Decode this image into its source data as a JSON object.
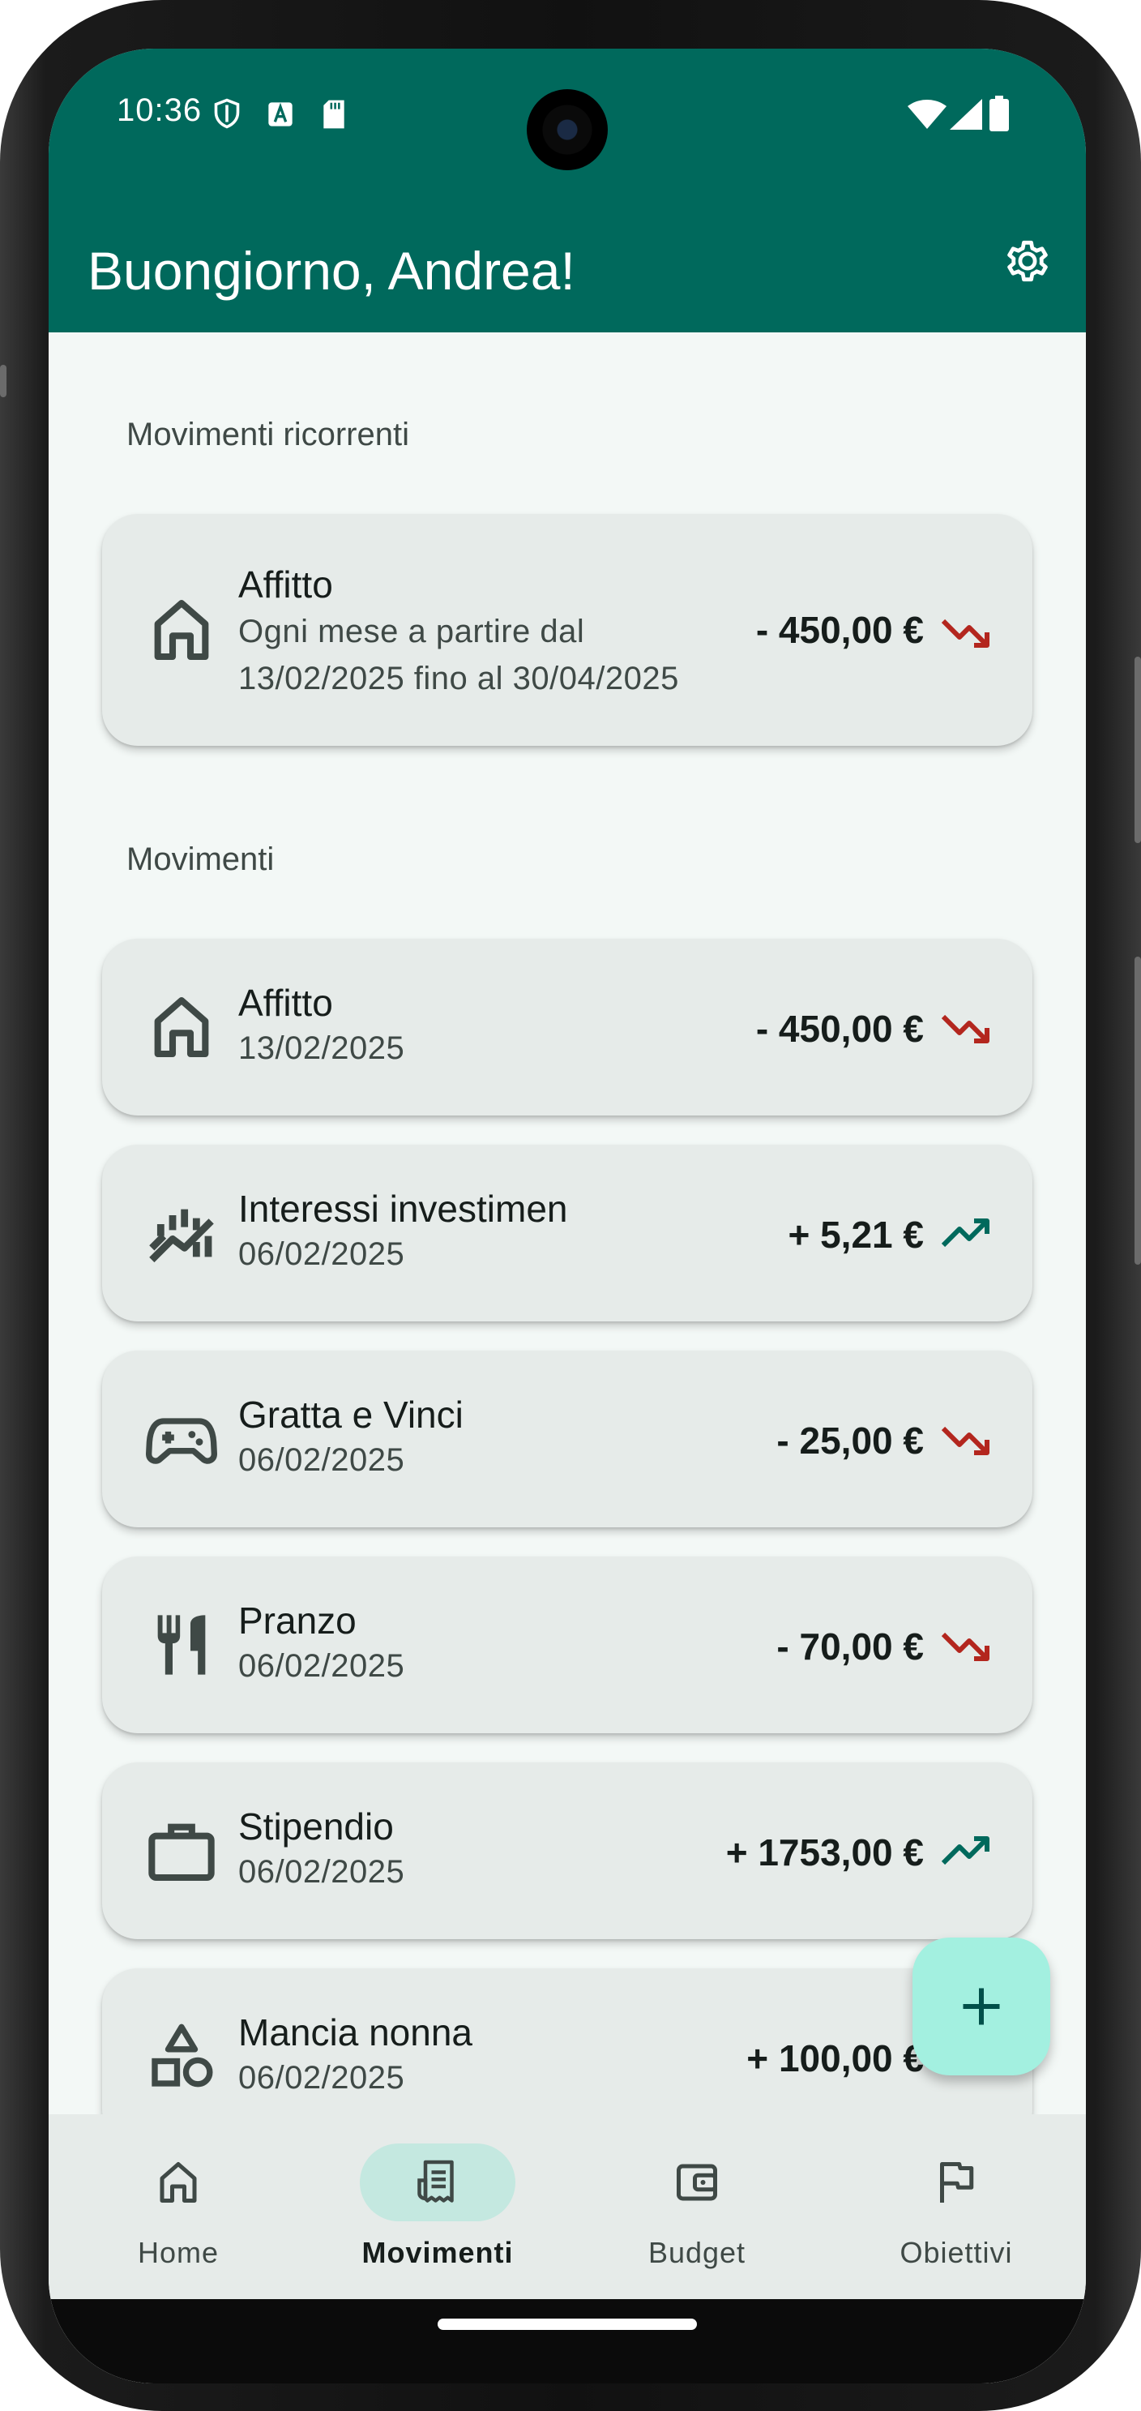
{
  "status": {
    "time": "10:36"
  },
  "header": {
    "greeting": "Buongiorno, Andrea!"
  },
  "colors": {
    "primary": "#00695c",
    "negative": "#b3261e",
    "positive": "#00695c",
    "card": "#e6ebe9",
    "fab": "#a3f0e0"
  },
  "recurring": {
    "section_title": "Movimenti ricorrenti",
    "items": [
      {
        "title": "Affitto",
        "line1": "Ogni mese a partire dal",
        "line2": "13/02/2025 fino al 30/04/2025",
        "amount": "- 450,00 €",
        "icon": "house-icon",
        "trend": "down"
      }
    ]
  },
  "movements": {
    "section_title": "Movimenti",
    "items": [
      {
        "title": "Affitto",
        "date": "13/02/2025",
        "amount": "- 450,00 €",
        "icon": "house-icon",
        "trend": "down"
      },
      {
        "title": "Interessi investimen",
        "date": "06/02/2025",
        "amount": "+ 5,21 €",
        "icon": "investment-chart-icon",
        "trend": "up"
      },
      {
        "title": "Gratta e Vinci",
        "date": "06/02/2025",
        "amount": "- 25,00 €",
        "icon": "gamepad-icon",
        "trend": "down"
      },
      {
        "title": "Pranzo",
        "date": "06/02/2025",
        "amount": "- 70,00 €",
        "icon": "fork-knife-icon",
        "trend": "down"
      },
      {
        "title": "Stipendio",
        "date": "06/02/2025",
        "amount": "+ 1753,00 €",
        "icon": "briefcase-icon",
        "trend": "up"
      },
      {
        "title": "Mancia nonna",
        "date": "06/02/2025",
        "amount": "+ 100,00 €",
        "icon": "shapes-icon",
        "trend": "up"
      }
    ]
  },
  "fab": {
    "icon": "plus-icon"
  },
  "nav": {
    "items": [
      {
        "label": "Home",
        "icon": "home-icon",
        "active": false
      },
      {
        "label": "Movimenti",
        "icon": "receipt-icon",
        "active": true
      },
      {
        "label": "Budget",
        "icon": "wallet-icon",
        "active": false
      },
      {
        "label": "Obiettivi",
        "icon": "flag-icon",
        "active": false
      }
    ]
  }
}
